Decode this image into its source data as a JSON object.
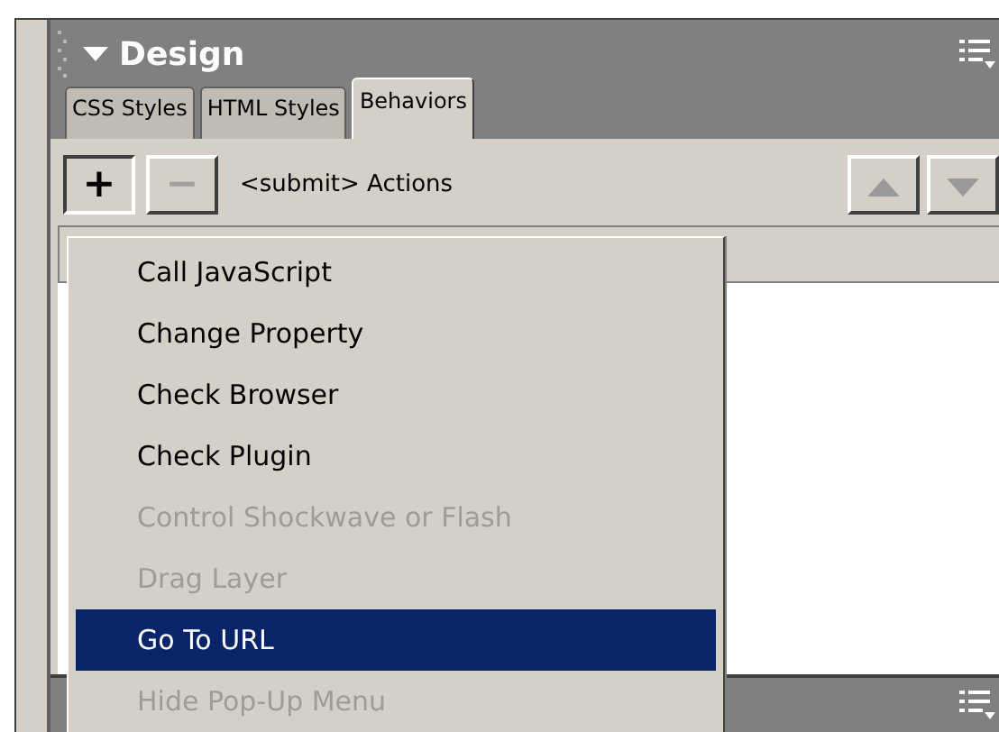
{
  "panel": {
    "title": "Design",
    "expanded": true
  },
  "tabs": [
    {
      "label": "CSS Styles",
      "selected": false
    },
    {
      "label": "HTML Styles",
      "selected": false
    },
    {
      "label": "Behaviors",
      "selected": true
    }
  ],
  "toolbar": {
    "add": {
      "label": "+",
      "pressed": true
    },
    "remove": {
      "label": "−",
      "disabled": true
    },
    "caption": "<submit> Actions"
  },
  "menu": [
    {
      "label": "Call JavaScript",
      "disabled": false,
      "selected": false
    },
    {
      "label": "Change Property",
      "disabled": false,
      "selected": false
    },
    {
      "label": "Check Browser",
      "disabled": false,
      "selected": false
    },
    {
      "label": "Check Plugin",
      "disabled": false,
      "selected": false
    },
    {
      "label": "Control Shockwave or Flash",
      "disabled": true,
      "selected": false
    },
    {
      "label": "Drag Layer",
      "disabled": true,
      "selected": false
    },
    {
      "label": "Go To URL",
      "disabled": false,
      "selected": true
    },
    {
      "label": "Hide Pop-Up Menu",
      "disabled": true,
      "selected": false
    }
  ]
}
